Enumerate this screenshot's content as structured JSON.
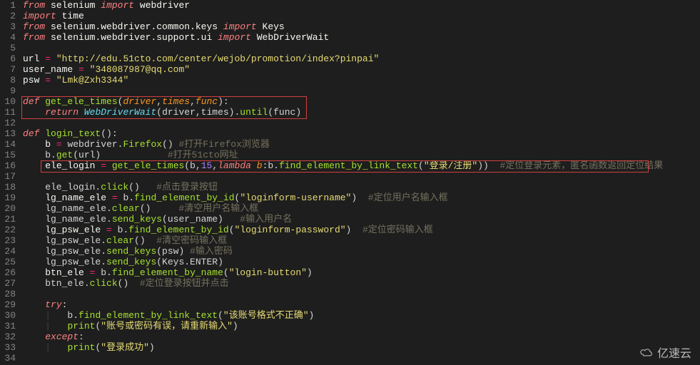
{
  "lines": [
    {
      "n": 1,
      "html": "<span class='kw'>from</span> <span class='var'>selenium</span> <span class='kw'>import</span> <span class='var'>webdriver</span>"
    },
    {
      "n": 2,
      "html": "<span class='kw'>import</span> <span class='var'>time</span>"
    },
    {
      "n": 3,
      "html": "<span class='kw'>from</span> <span class='var'>selenium.webdriver.common.keys</span> <span class='kw'>import</span> <span class='var'>Keys</span>"
    },
    {
      "n": 4,
      "html": "<span class='kw'>from</span> <span class='var'>selenium.webdriver.support.ui</span> <span class='kw'>import</span> <span class='var'>WebDriverWait</span>"
    },
    {
      "n": 5,
      "html": ""
    },
    {
      "n": 6,
      "html": "<span class='var'>url</span> <span class='op'>=</span> <span class='str'>\"http://edu.51cto.com/center/wejob/promotion/index?pinpai\"</span>"
    },
    {
      "n": 7,
      "html": "<span class='var'>user_name</span> <span class='op'>=</span> <span class='str'>\"348087987@qq.com\"</span>"
    },
    {
      "n": 8,
      "html": "<span class='var'>psw</span> <span class='op'>=</span> <span class='str'>\"Lmk@Zxh3344\"</span>"
    },
    {
      "n": 9,
      "html": ""
    },
    {
      "n": 10,
      "html": "<span class='kw2'>def</span> <span class='fn'>get_ele_times</span>(<span class='param'>driver</span>,<span class='param'>times</span>,<span class='param'>func</span>):"
    },
    {
      "n": 11,
      "html": "    <span class='kw'>return</span> <span class='cls'>WebDriverWait</span>(driver,times).<span class='fn'>until</span>(func)"
    },
    {
      "n": 12,
      "html": ""
    },
    {
      "n": 13,
      "html": "<span class='kw2'>def</span> <span class='fn'>login_text</span>():"
    },
    {
      "n": 14,
      "html": "    <span class='var'>b</span> <span class='op'>=</span> webdriver.<span class='fn'>Firefox</span>() <span class='comment'>#打开Firefox浏览器</span>"
    },
    {
      "n": 15,
      "html": "    b.<span class='fn'>get</span>(url)            <span class='comment'>#打开51cto网址</span>"
    },
    {
      "n": 16,
      "html": "    <span class='var'>ele_login</span> <span class='op'>=</span> <span class='fn'>get_ele_times</span>(b,<span class='num'>15</span>,<span class='kw2'>lambda</span> <span class='param'>b</span>:b.<span class='fn'>find_element_by_link_text</span>(<span class='str'>\"登录/注册\"</span>))  <span class='comment'>#定位登录元素，匿名函数返回定位结果</span>"
    },
    {
      "n": 17,
      "html": ""
    },
    {
      "n": 18,
      "html": "    ele_login.<span class='fn'>click</span>()   <span class='comment'>#点击登录按钮</span>"
    },
    {
      "n": 19,
      "html": "    <span class='var'>lg_name_ele</span> <span class='op'>=</span> b.<span class='fn'>find_element_by_id</span>(<span class='str'>\"loginform-username\"</span>)  <span class='comment'>#定位用户名输入框</span>"
    },
    {
      "n": 20,
      "html": "    lg_name_ele.<span class='fn'>clear</span>()     <span class='comment'>#清空用户名输入框</span>"
    },
    {
      "n": 21,
      "html": "    lg_name_ele.<span class='fn'>send_keys</span>(user_name)   <span class='comment'>#输入用户名</span>"
    },
    {
      "n": 22,
      "html": "    <span class='var'>lg_psw_ele</span> <span class='op'>=</span> b.<span class='fn'>find_element_by_id</span>(<span class='str'>\"loginform-password\"</span>)  <span class='comment'>#定位密码输入框</span>"
    },
    {
      "n": 23,
      "html": "    lg_psw_ele.<span class='fn'>clear</span>()  <span class='comment'>#清空密码输入框</span>"
    },
    {
      "n": 24,
      "html": "    lg_psw_ele.<span class='fn'>send_keys</span>(psw) <span class='comment'>#输入密码</span>"
    },
    {
      "n": 25,
      "html": "    lg_psw_ele.<span class='fn'>send_keys</span>(Keys.ENTER)"
    },
    {
      "n": 26,
      "html": "    <span class='var'>btn_ele</span> <span class='op'>=</span> b.<span class='fn'>find_element_by_name</span>(<span class='str'>\"login-button\"</span>)"
    },
    {
      "n": 27,
      "html": "    btn_ele.<span class='fn'>click</span>()  <span class='comment'>#定位登录按钮并点击</span>"
    },
    {
      "n": 28,
      "html": ""
    },
    {
      "n": 29,
      "html": "    <span class='kw'>try</span>:"
    },
    {
      "n": 30,
      "html": "    <span class='indent-guide'>|</span>   b.<span class='fn'>find_element_by_link_text</span>(<span class='str'>\"该账号格式不正确\"</span>)"
    },
    {
      "n": 31,
      "html": "    <span class='indent-guide'>|</span>   <span class='fn'>print</span>(<span class='str'>\"账号或密码有误，请重新输入\"</span>)"
    },
    {
      "n": 32,
      "html": "    <span class='kw'>except</span>:"
    },
    {
      "n": 33,
      "html": "    <span class='indent-guide'>|</span>   <span class='fn'>print</span>(<span class='str'>\"登录成功\"</span>)"
    },
    {
      "n": 34,
      "html": ""
    }
  ],
  "watermark_text": "亿速云"
}
